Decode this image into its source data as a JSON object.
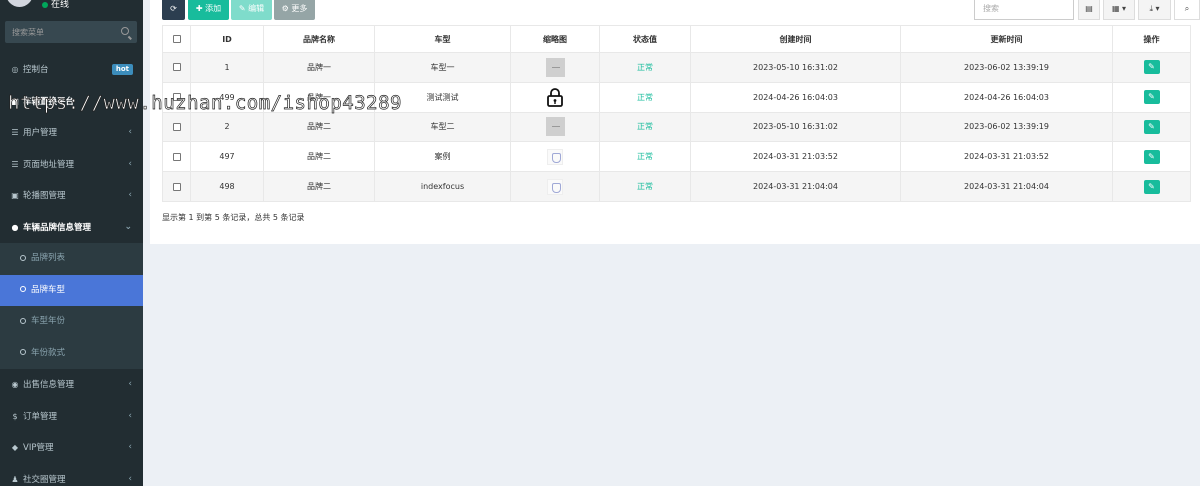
{
  "sidebar": {
    "status": "在线",
    "search_placeholder": "搜索菜单",
    "items": [
      {
        "icon": "dashboard-icon",
        "glyph": "◎",
        "label": "控制台",
        "badge": "hot"
      },
      {
        "icon": "car-icon",
        "glyph": "■",
        "label": "车辆置换平台"
      },
      {
        "icon": "list-icon",
        "glyph": "☰",
        "label": "用户管理",
        "caret": "‹"
      },
      {
        "icon": "list-icon",
        "glyph": "☰",
        "label": "页面地址管理",
        "caret": "‹"
      },
      {
        "icon": "image-icon",
        "glyph": "▣",
        "label": "轮播图管理",
        "caret": "‹"
      },
      {
        "icon": "p-circle-icon",
        "glyph": "●",
        "label": "车辆品牌信息管理",
        "caret": "⌄"
      },
      {
        "label": "品牌列表"
      },
      {
        "label": "品牌车型"
      },
      {
        "label": "车型年份"
      },
      {
        "label": "年份款式"
      },
      {
        "icon": "eye-icon",
        "glyph": "◉",
        "label": "出售信息管理",
        "caret": "‹"
      },
      {
        "icon": "dollar-icon",
        "glyph": "$",
        "label": "订单管理",
        "caret": "‹"
      },
      {
        "icon": "gem-icon",
        "glyph": "◆",
        "label": "VIP管理",
        "caret": "‹"
      },
      {
        "icon": "users-icon",
        "glyph": "♟",
        "label": "社交圈管理",
        "caret": "‹"
      }
    ]
  },
  "watermark": "https://www.huzhan.com/ishop43289",
  "toolbar": {
    "refresh_glyph": "⟳",
    "add_label": "✚ 添加",
    "edit_label": "✎ 编辑",
    "more_label": "⚙ 更多",
    "search_placeholder": "搜索",
    "cols_glyph": "▤",
    "grid_glyph": "▦ ▾",
    "export_glyph": "⤓ ▾",
    "search_glyph": "⌕"
  },
  "table": {
    "headers": [
      "",
      "ID",
      "品牌名称",
      "车型",
      "缩略图",
      "状态值",
      "创建时间",
      "更新时间",
      "操作"
    ],
    "rows": [
      {
        "id": "1",
        "brand": "品牌一",
        "model": "车型一",
        "thumb": "gray",
        "status": "正常",
        "created": "2023-05-10 16:31:02",
        "updated": "2023-06-02 13:39:19"
      },
      {
        "id": "499",
        "brand": "品牌一",
        "model": "测试测试",
        "thumb": "lock",
        "status": "正常",
        "created": "2024-04-26 16:04:03",
        "updated": "2024-04-26 16:04:03"
      },
      {
        "id": "2",
        "brand": "品牌二",
        "model": "车型二",
        "thumb": "gray",
        "status": "正常",
        "created": "2023-05-10 16:31:02",
        "updated": "2023-06-02 13:39:19"
      },
      {
        "id": "497",
        "brand": "品牌二",
        "model": "案例",
        "thumb": "shield",
        "status": "正常",
        "created": "2024-03-31 21:03:52",
        "updated": "2024-03-31 21:03:52"
      },
      {
        "id": "498",
        "brand": "品牌二",
        "model": "indexfocus",
        "thumb": "shield",
        "status": "正常",
        "created": "2024-03-31 21:04:04",
        "updated": "2024-03-31 21:04:04"
      }
    ],
    "edit_glyph": "✎"
  },
  "pagination_text": "显示第 1 到第 5 条记录，总共 5 条记录"
}
